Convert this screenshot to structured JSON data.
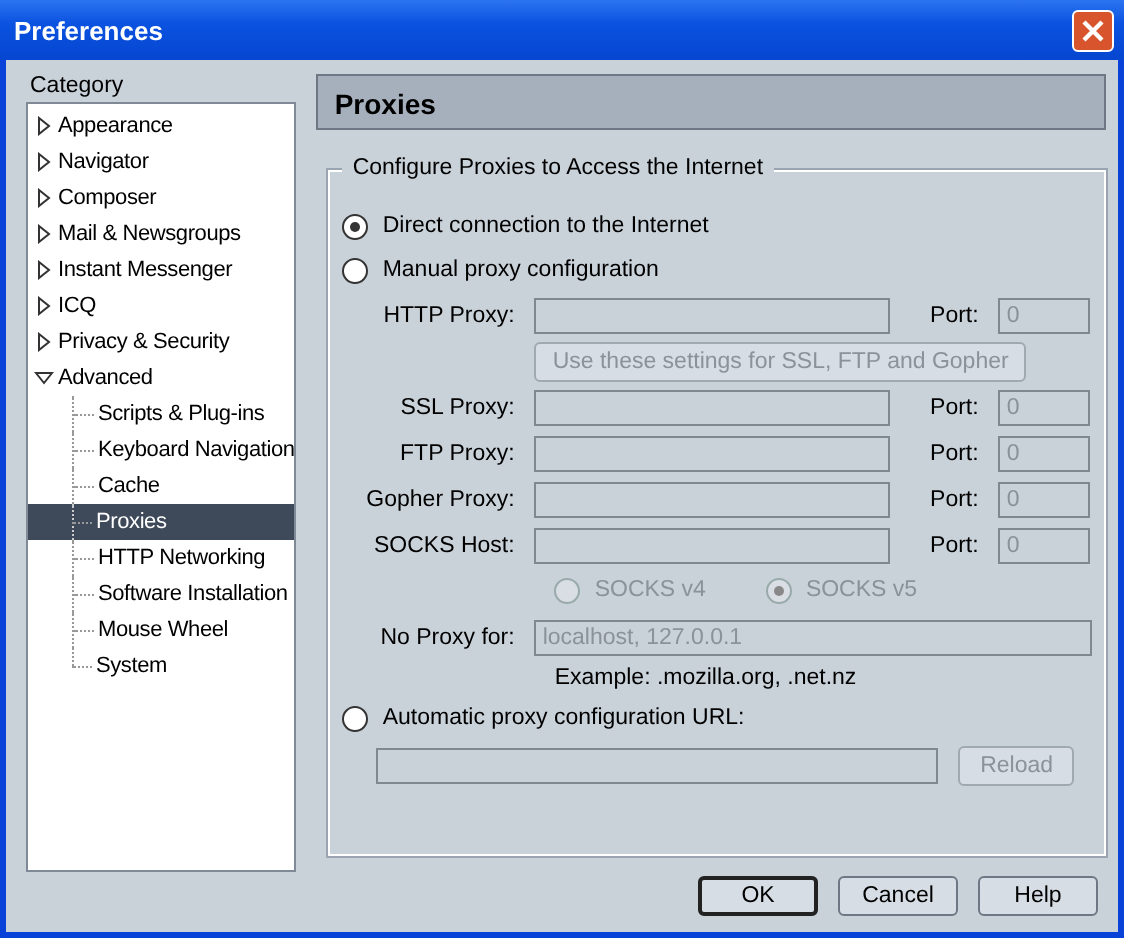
{
  "window": {
    "title": "Preferences"
  },
  "sidebar": {
    "heading": "Category",
    "items": [
      {
        "label": "Appearance",
        "expanded": false,
        "selected": false
      },
      {
        "label": "Navigator",
        "expanded": false,
        "selected": false
      },
      {
        "label": "Composer",
        "expanded": false,
        "selected": false
      },
      {
        "label": "Mail & Newsgroups",
        "expanded": false,
        "selected": false
      },
      {
        "label": "Instant Messenger",
        "expanded": false,
        "selected": false
      },
      {
        "label": "ICQ",
        "expanded": false,
        "selected": false
      },
      {
        "label": "Privacy & Security",
        "expanded": false,
        "selected": false
      },
      {
        "label": "Advanced",
        "expanded": true,
        "selected": false,
        "children": [
          {
            "label": "Scripts & Plug-ins",
            "selected": false
          },
          {
            "label": "Keyboard Navigation",
            "selected": false
          },
          {
            "label": "Cache",
            "selected": false
          },
          {
            "label": "Proxies",
            "selected": true
          },
          {
            "label": "HTTP Networking",
            "selected": false
          },
          {
            "label": "Software Installation",
            "selected": false
          },
          {
            "label": "Mouse Wheel",
            "selected": false
          },
          {
            "label": "System",
            "selected": false
          }
        ]
      }
    ]
  },
  "panel": {
    "title": "Proxies",
    "group_title": "Configure Proxies to Access the Internet",
    "modes": [
      {
        "label": "Direct connection to the Internet",
        "selected": true
      },
      {
        "label": "Manual proxy configuration",
        "selected": false
      }
    ],
    "manual": {
      "disabled": true,
      "proxies": [
        {
          "label": "HTTP Proxy:",
          "port_label": "Port:",
          "port": "0"
        },
        {
          "kind": "button",
          "label": "Use these settings for SSL, FTP and Gopher"
        },
        {
          "label": "SSL Proxy:",
          "port_label": "Port:",
          "port": "0"
        },
        {
          "label": "FTP Proxy:",
          "port_label": "Port:",
          "port": "0"
        },
        {
          "label": "Gopher Proxy:",
          "port_label": "Port:",
          "port": "0"
        },
        {
          "label": "SOCKS Host:",
          "port_label": "Port:",
          "port": "0"
        }
      ],
      "socks_versions": [
        {
          "label": "SOCKS v4",
          "selected": false
        },
        {
          "label": "SOCKS v5",
          "selected": true
        }
      ],
      "no_proxy": {
        "label": "No Proxy for:",
        "value": "localhost, 127.0.0.1"
      },
      "example": "Example: .mozilla.org, .net.nz"
    },
    "auto": {
      "label": "Automatic proxy configuration URL:",
      "selected": false,
      "button": "Reload",
      "button_disabled": true
    }
  },
  "buttons": [
    {
      "label": "OK",
      "default": true
    },
    {
      "label": "Cancel",
      "default": false
    },
    {
      "label": "Help",
      "default": false
    }
  ]
}
